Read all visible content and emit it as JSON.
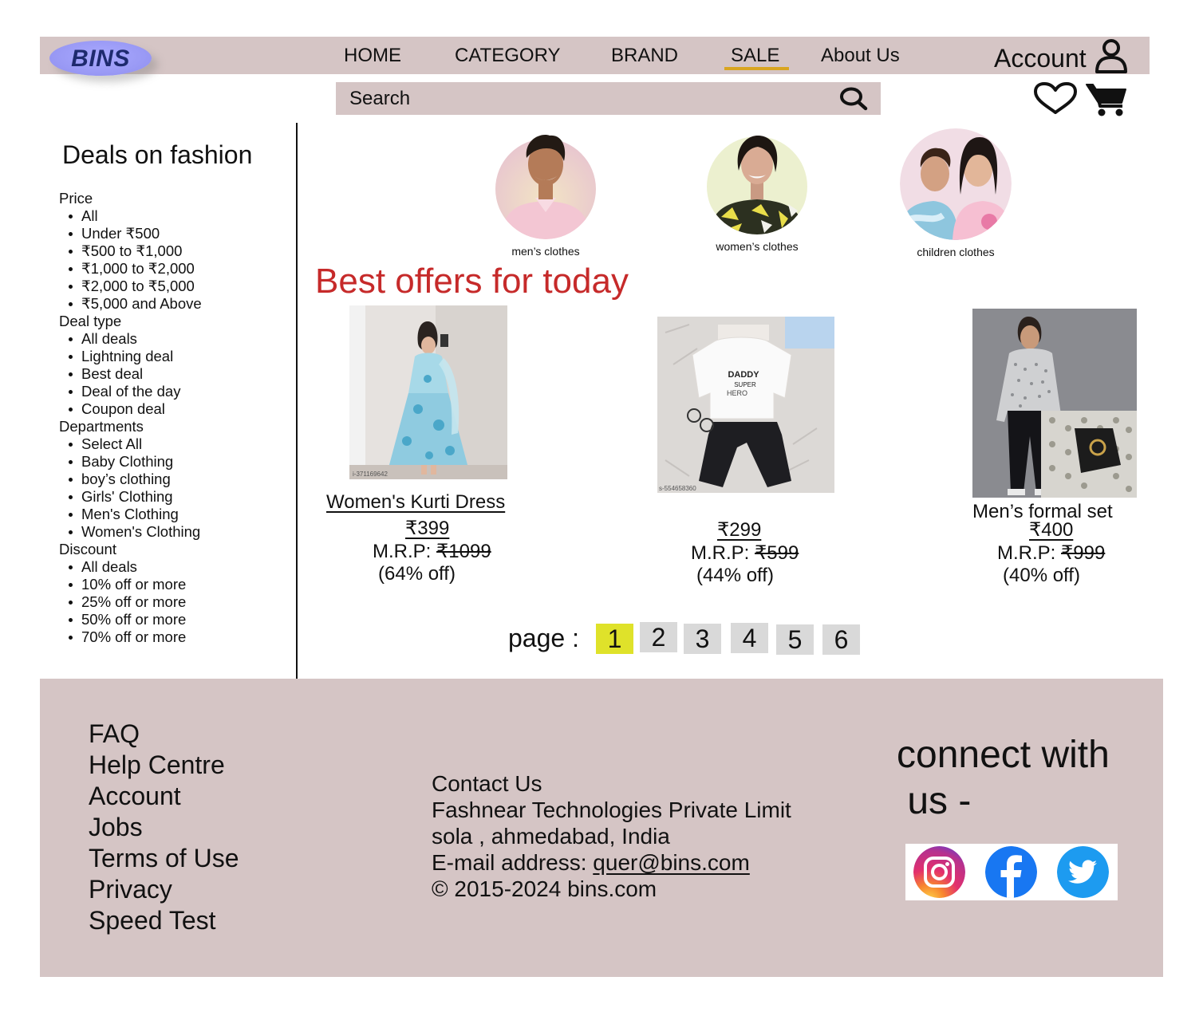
{
  "header": {
    "logo_text": "BINS",
    "nav": [
      "HOME",
      "CATEGORY",
      "BRAND",
      "SALE",
      "About Us"
    ],
    "active_nav": "SALE",
    "account_label": "Account",
    "search_placeholder": "Search"
  },
  "sidebar": {
    "title": "Deals on fashion",
    "groups": [
      {
        "title": "Price",
        "items": [
          "All",
          "Under ₹500",
          "₹500 to ₹1,000",
          "₹1,000 to ₹2,000",
          "₹2,000 to ₹5,000",
          "₹5,000 and Above"
        ]
      },
      {
        "title": "Deal type",
        "items": [
          "All deals",
          "Lightning deal",
          "Best deal",
          "Deal of the day",
          "Coupon deal"
        ]
      },
      {
        "title": "Departments",
        "items": [
          "Select All",
          "Baby Clothing",
          "boy’s clothing",
          "Girls' Clothing",
          "Men's Clothing",
          "Women's Clothing"
        ]
      },
      {
        "title": "Discount",
        "items": [
          "All deals",
          "10% off or more",
          "25% off or more",
          "50% off or more",
          "70% off or more"
        ]
      }
    ]
  },
  "categories": [
    {
      "label": "men’s clothes"
    },
    {
      "label": "women’s clothes"
    },
    {
      "label": "children clothes"
    }
  ],
  "offers_title": "Best offers for today",
  "products": [
    {
      "name": "Women's  Kurti Dress",
      "price": "₹399",
      "mrp_label": "M.R.P: ",
      "mrp": "₹1099",
      "discount": "(64% off)",
      "img_code": "i-371169642"
    },
    {
      "name": "",
      "price": "₹299",
      "mrp_label": "M.R.P: ",
      "mrp": "₹599 ",
      "discount": "(44% off)",
      "img_code": "s-554658360",
      "shirt_text": [
        "DADDY",
        "SUPER",
        "HERO"
      ]
    },
    {
      "name": "Men’s formal set",
      "price": "₹400",
      "mrp_label": "M.R.P: ",
      "mrp": "₹999 ",
      "discount": "(40% off)"
    }
  ],
  "pagination": {
    "label": "page :",
    "pages": [
      "1",
      "2",
      "3",
      "4",
      "5",
      "6"
    ],
    "active": "1"
  },
  "footer": {
    "links": [
      "FAQ",
      "Help Centre",
      "Account",
      "Jobs",
      "Terms of Use",
      "Privacy",
      "Speed Test"
    ],
    "contact_title": "Contact Us",
    "company": "Fashnear Technologies Private Limit",
    "address": "sola , ahmedabad, India",
    "email_label": "E-mail address: ",
    "email": "quer@bins.com",
    "copyright": "© 2015-2024 bins.com",
    "connect_line1": "connect with",
    "connect_line2": " us -"
  },
  "social": [
    "instagram-icon",
    "facebook-icon",
    "twitter-icon"
  ],
  "colors": {
    "panel": "#d5c5c5",
    "sale_underline": "#d9a520",
    "offers_title": "#c62a2a",
    "active_page": "#dfe22a",
    "page_button": "#d9d9d9"
  }
}
